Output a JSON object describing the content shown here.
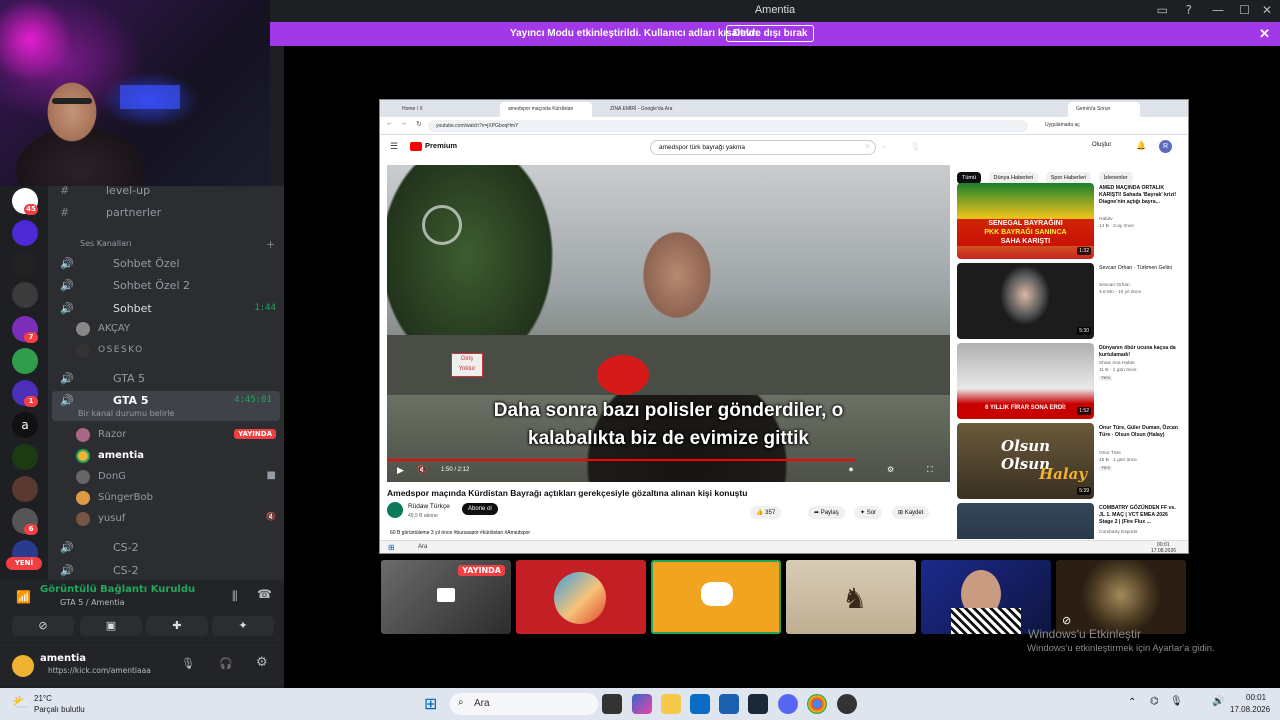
{
  "window": {
    "title": "Amentia"
  },
  "banner": {
    "message": "Yayıncı Modu etkinleştirildi. Kullanıcı adları kısaltıldı.",
    "button": "Devre dışı bırak"
  },
  "rail": {
    "badges": [
      "45",
      "7",
      "1",
      "6"
    ],
    "new_label": "YENİ"
  },
  "channels": {
    "text": [
      {
        "name": "level-up"
      },
      {
        "name": "partnerler"
      }
    ],
    "voice_category": "Ses Kanalları",
    "voice": [
      {
        "name": "Sohbet Özel"
      },
      {
        "name": "Sohbet Özel 2"
      },
      {
        "name": "Sohbet",
        "time": "1:44"
      }
    ],
    "sohbet_users": [
      "AKÇAY",
      "OSESKO"
    ],
    "gta1": {
      "name": "GTA 5"
    },
    "gta2": {
      "name": "GTA 5",
      "time": "4:45:01",
      "status_placeholder": "Bir kanal durumu belirle"
    },
    "gta_users": [
      {
        "name": "Razor",
        "live": "YAYINDA"
      },
      {
        "name": "amentia"
      },
      {
        "name": "DonG"
      },
      {
        "name": "SüngerBob"
      },
      {
        "name": "yusuf"
      }
    ],
    "cs": [
      {
        "name": "CS-2"
      },
      {
        "name": "CS-2"
      }
    ]
  },
  "voice_panel": {
    "status": "Görüntülü Bağlantı Kuruldu",
    "channel": "GTA 5 / Amentia"
  },
  "user_panel": {
    "name": "amentia",
    "status": "https://kick.com/amentiaaa"
  },
  "browser": {
    "tabs": [
      "Home / X",
      "amedspor maçında Kürdistan",
      "ZİNA EMİRİ - Google'da Ara"
    ],
    "gemini_tab": "Gemini'a Sorun",
    "url": "youtube.com/watch?v=jXPGboqHmY",
    "apps_label": "Uygulamada aç",
    "youtube": {
      "logo": "Premium",
      "search_value": "amedspor türk bayrağı yakma",
      "create_label": "Oluştur",
      "avatar": "R"
    },
    "video": {
      "subtitle_line1": "Daha sonra bazı polisler gönderdiler, o",
      "subtitle_line2": "kalabalıkta biz de evimize gittik",
      "time": "1:50 / 2:12",
      "title": "Amedspor maçında Kürdistan Bayrağı açtıkları gerekçesiyle gözaltına alınan kişi konuştu",
      "channel": "Rûdaw Türkçe",
      "subscribers": "49,5 B abone",
      "subscribe": "Abone ol",
      "likes": "357",
      "share": "Paylaş",
      "ask": "Sor",
      "save": "Kaydet",
      "meta": "60 B görüntüleme  3 yıl önce  #bursaspor #kürdistan #Amedspor",
      "sign_words": [
        "Giriş",
        "Yoktur"
      ]
    },
    "chips": [
      "Tümü",
      "Dünya Haberleri",
      "Spor Haberleri",
      "İzlenenler"
    ],
    "recommendations": [
      {
        "title": "AMED MAÇINDA ORTALIK KARIŞTI! Sahada 'Bayrak' krizi! Diagne'nin açtığı bayra...",
        "channel": "Habitv",
        "meta": "14 B · 3 ay önce",
        "duration": "1:32",
        "thumb_text": [
          "SENEGAL BAYRAĞINI",
          "PKK BAYRAĞI SANINCA",
          "SAHA KARIŞTI"
        ]
      },
      {
        "title": "Sevcan Orhan - Türkmen Gelini",
        "channel": "Sevcan Orhan",
        "meta": "4,8 Mn · 10 yıl önce",
        "duration": "5:30",
        "thumb_text": []
      },
      {
        "title": "Dünyanın öbür ucuna kaçsa da kurtulamadı!",
        "channel": "Show Ana Haber",
        "meta": "11 B · 1 gün önce",
        "duration": "1:52",
        "badge": "Yeni",
        "thumb_text": [
          "6 YILLIK FİRAR SONA ERDİ!"
        ]
      },
      {
        "title": "Onur Türe, Güler Duman, Özcan Türe - Olsun Olsun (Halay)",
        "channel": "Onur Türe",
        "meta": "45 B · 1 gün önce",
        "duration": "5:39",
        "badge": "Yeni",
        "thumb_text": [
          "Olsun Olsun",
          "Halay"
        ]
      },
      {
        "title": "COMBATRY GÖZÜNDEN FF vs. JL 1. MAÇ | VCT EMEA 2026 Stage 2 | (Fire Flux ...",
        "channel": "Combatry Esports",
        "meta": "",
        "duration": "",
        "thumb_text": []
      }
    ],
    "inner_taskbar": {
      "search": "Ara",
      "clock": "00:01",
      "date": "17.08.2026"
    }
  },
  "tiles": [
    {
      "label": "YAYINDA"
    },
    {
      "label": ""
    },
    {
      "label": ""
    },
    {
      "label": ""
    },
    {
      "label": ""
    },
    {
      "label": ""
    }
  ],
  "watermark": {
    "line1": "Windows'u Etkinleştir",
    "line2": "Windows'u etkinleştirmek için Ayarlar'a gidin."
  },
  "taskbar": {
    "weather_temp": "21°C",
    "weather_desc": "Parçalı bulutlu",
    "search": "Ara",
    "time": "00:01",
    "date": "17.08.2026"
  },
  "colors": {
    "banner": "#a239e8",
    "live": "#f23f43",
    "green": "#23a55a",
    "highlight": "#f0b232"
  }
}
